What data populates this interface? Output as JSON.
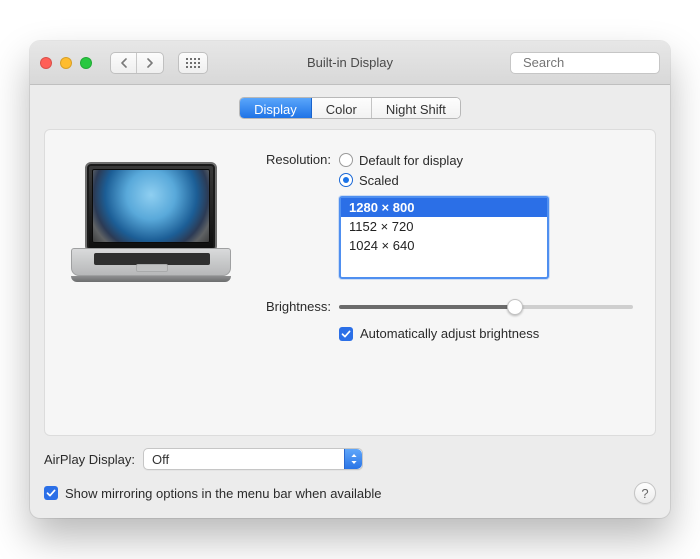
{
  "header": {
    "title": "Built-in Display",
    "search_placeholder": "Search",
    "back_icon": "chevron-left-icon",
    "forward_icon": "chevron-right-icon",
    "apps_icon": "grid-icon"
  },
  "tabs": [
    {
      "label": "Display",
      "active": true
    },
    {
      "label": "Color",
      "active": false
    },
    {
      "label": "Night Shift",
      "active": false
    }
  ],
  "resolution": {
    "label": "Resolution:",
    "options": [
      {
        "label": "Default for display",
        "selected": false
      },
      {
        "label": "Scaled",
        "selected": true
      }
    ],
    "scaled_values": [
      {
        "label": "1280 × 800",
        "selected": true
      },
      {
        "label": "1152 × 720",
        "selected": false
      },
      {
        "label": "1024 × 640",
        "selected": false
      }
    ]
  },
  "brightness": {
    "label": "Brightness:",
    "value_pct": 60,
    "auto_label": "Automatically adjust brightness",
    "auto_checked": true
  },
  "airplay": {
    "label": "AirPlay Display:",
    "selected": "Off"
  },
  "mirroring": {
    "label": "Show mirroring options in the menu bar when available",
    "checked": true
  },
  "help": "?"
}
